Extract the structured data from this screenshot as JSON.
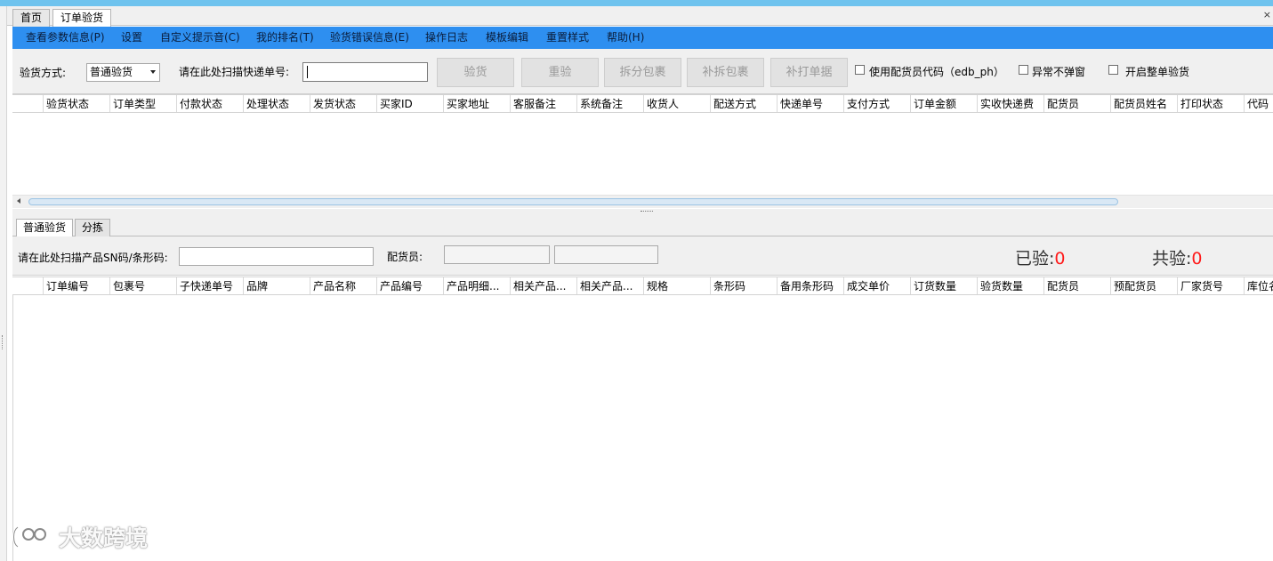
{
  "doc_tabs": {
    "home": "首页",
    "order_check": "订单验货",
    "close": "×"
  },
  "menu": {
    "items": [
      "查看参数信息(P)",
      "设置",
      "自定义提示音(C)",
      "我的排名(T)",
      "验货错误信息(E)",
      "操作日志",
      "模板编辑",
      "重置样式",
      "帮助(H)"
    ]
  },
  "toolbar": {
    "mode_label": "验货方式:",
    "mode_value": "普通验货",
    "scan_label": "请在此处扫描快递单号:",
    "scan_value": "",
    "buttons": [
      "验货",
      "重验",
      "拆分包裹",
      "补拆包裹",
      "补打单据"
    ],
    "checkboxes": [
      "使用配货员代码（edb_ph）",
      "异常不弹窗",
      "开启整单验货"
    ]
  },
  "orders_grid": {
    "columns": [
      "验货状态",
      "订单类型",
      "付款状态",
      "处理状态",
      "发货状态",
      "买家ID",
      "买家地址",
      "客服备注",
      "系统备注",
      "收货人",
      "配送方式",
      "快递单号",
      "支付方式",
      "订单金额",
      "实收快递费",
      "配货员",
      "配货员姓名",
      "打印状态",
      "代码"
    ]
  },
  "sub_tabs": {
    "normal": "普通验货",
    "sorting": "分拣"
  },
  "scanbar": {
    "product_label": "请在此处扫描产品SN码/条形码:",
    "picker_label": "配货员:",
    "checked_label": "已验:",
    "checked_value": "0",
    "total_label": "共验:",
    "total_value": "0"
  },
  "items_grid": {
    "columns": [
      "订单编号",
      "包裹号",
      "子快递单号",
      "品牌",
      "产品名称",
      "产品编号",
      "产品明细...",
      "相关产品...",
      "相关产品...",
      "规格",
      "条形码",
      "备用条形码",
      "成交单价",
      "订货数量",
      "验货数量",
      "配货员",
      "预配货员",
      "厂家货号",
      "库位名"
    ]
  },
  "watermark": {
    "text": "大数跨境"
  }
}
